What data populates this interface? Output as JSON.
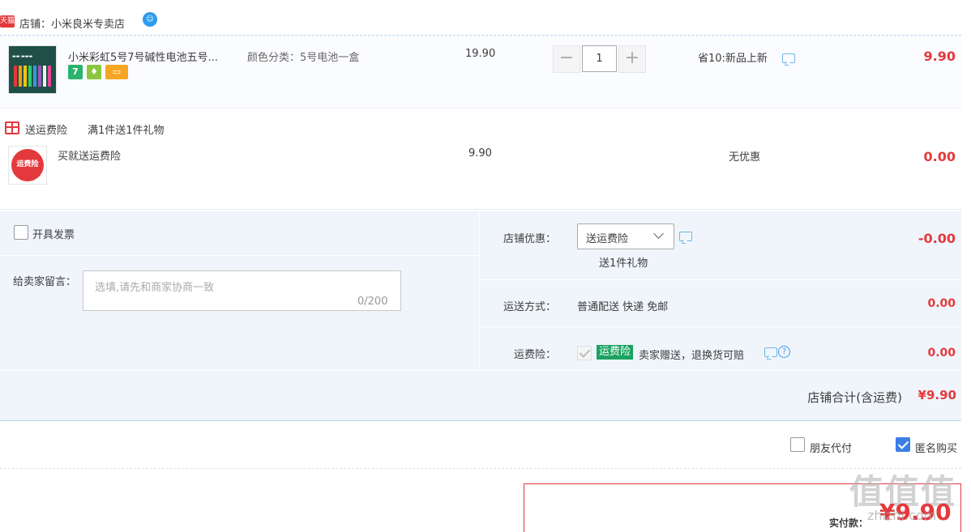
{
  "shop": {
    "badge": "天猫",
    "name": "店铺：小米良米专卖店",
    "wangwang_icon": "wangwang-chat-icon"
  },
  "item1": {
    "title": "小米彩虹5号7号碱性电池五号...",
    "sku": "颜色分类：5号电池一盒",
    "unit_price": "19.90",
    "quantity": "1",
    "minus": "−",
    "plus": "+",
    "promo": "省10:新品上新",
    "subtotal": "9.90",
    "service_icons": [
      "seven-day-return-icon",
      "android-service-icon",
      "credit-card-icon"
    ],
    "service_badge_text": "7"
  },
  "gift": {
    "label": "送运费险",
    "desc": "满1件送1件礼物",
    "thumb_text": "运费险",
    "title": "买就送运费险",
    "unit_price": "9.90",
    "promo": "无优惠",
    "subtotal": "0.00"
  },
  "options": {
    "invoice_label": "开具发票",
    "memo_label": "给卖家留言：",
    "memo_placeholder": "选填,请先和商家协商一致",
    "memo_count": "0/200",
    "shop_promo_label": "店铺优惠：",
    "shop_promo_selected": "送运费险",
    "shop_promo_sub": "送1件礼物",
    "shop_promo_amount": "-0.00",
    "ship_label": "运送方式：",
    "ship_method": "普通配送 快递 免邮",
    "ship_amount": "0.00",
    "insurance_label": "运费险：",
    "insurance_badge": "运费险",
    "insurance_desc": "卖家赠送，退换货可赔",
    "insurance_help": "?",
    "insurance_amount": "0.00",
    "total_label": "店铺合计(含运费)",
    "total_amount": "¥9.90"
  },
  "footer": {
    "friend_pay_label": "朋友代付",
    "anonymous_label": "匿名购买",
    "pay_label": "实付款：",
    "pay_amount": "¥9.90",
    "watermark_text": "值值值",
    "watermark_url": "zhizhi.com"
  },
  "colors": {
    "accent_red": "#e4393c",
    "panel_bg": "#f0f5fb",
    "checkbox_blue": "#3c7ee6",
    "insurance_green": "#1aa260"
  }
}
